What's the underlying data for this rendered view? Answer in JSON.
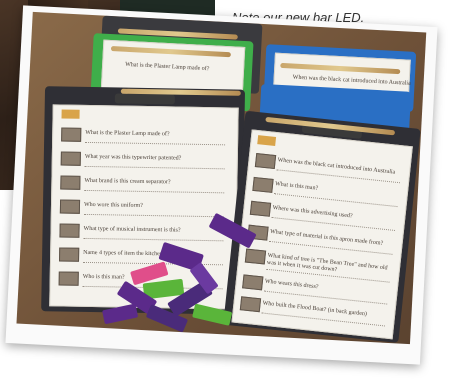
{
  "caption": "Note our new bar LED.",
  "left_sheet": {
    "questions": [
      "What is the Plaster Lamp made of?",
      "What year was this typewriter patented?",
      "What brand is this cream separator?",
      "Who wore this uniform?",
      "What type of musical instrument is this?",
      "Name 4 types of item the kitchen",
      "Who is this man?"
    ]
  },
  "right_sheet": {
    "questions": [
      "When was the black cat introduced into Australia",
      "What is this man?",
      "Where was this advertising used?",
      "What type of material is this apron made from?",
      "What kind of tree is \"The Bean Tree\" and how old was it when it was cut down?",
      "Who wears this dress?",
      "Who built the Flood Boat? (in back garden)"
    ]
  },
  "back_sheets": {
    "left_top": "What is the Plaster Lamp made of?",
    "right_top": "When was the black cat introduced into Australia"
  },
  "colors": {
    "board_dark": "#2f2f35",
    "board_green": "#3fae4a",
    "board_blue": "#2a6fc4",
    "candy_purple": "#5b2a8a",
    "candy_green": "#5ab53a"
  }
}
